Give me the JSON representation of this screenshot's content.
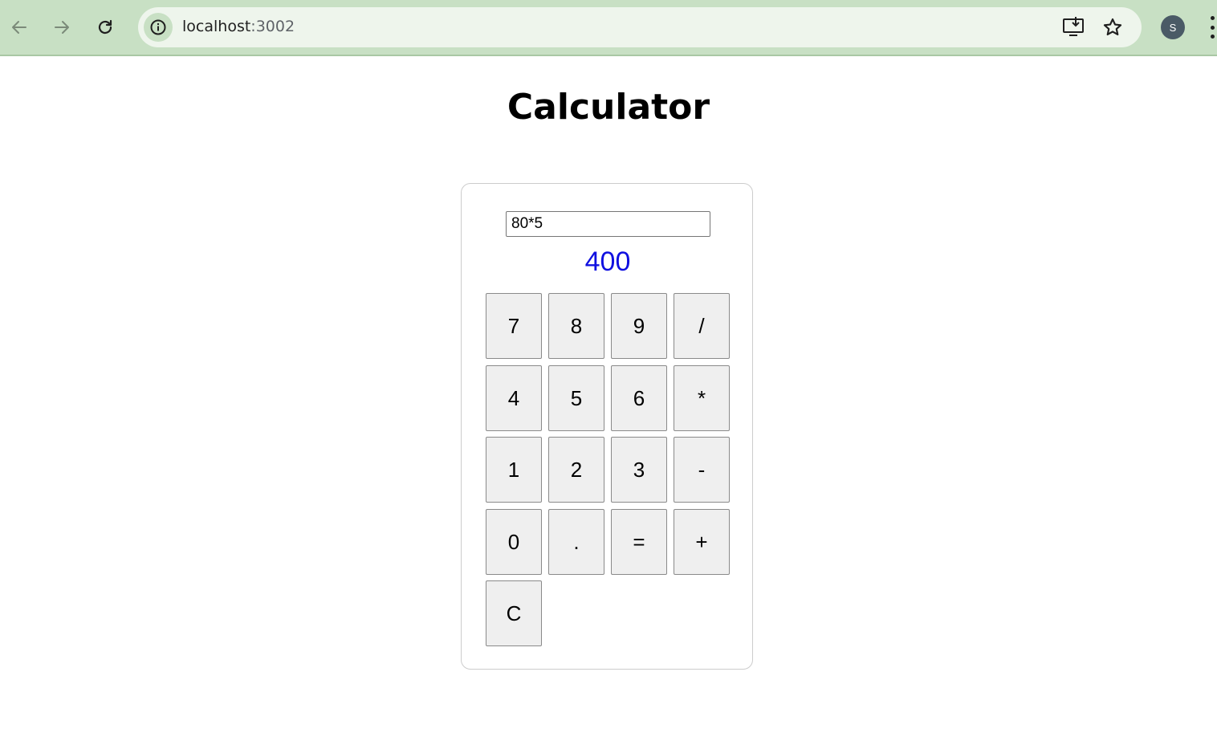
{
  "browser": {
    "url_host": "localhost",
    "url_port": ":3002",
    "profile_initial": "S",
    "icons": {
      "back": "arrow-left-icon",
      "forward": "arrow-right-icon",
      "reload": "reload-icon",
      "site_info": "info-icon",
      "install": "install-app-icon",
      "bookmark": "star-icon",
      "menu": "kebab-menu-icon"
    },
    "colors": {
      "toolbar": "#c8e0c4",
      "omnibox": "#eef5ec",
      "avatar": "#4a5a66"
    }
  },
  "page": {
    "title": "Calculator"
  },
  "calculator": {
    "expression": "80*5",
    "result": "400",
    "result_color": "#1010e0",
    "keys": [
      {
        "label": "7"
      },
      {
        "label": "8"
      },
      {
        "label": "9"
      },
      {
        "label": "/"
      },
      {
        "label": "4"
      },
      {
        "label": "5"
      },
      {
        "label": "6"
      },
      {
        "label": "*"
      },
      {
        "label": "1"
      },
      {
        "label": "2"
      },
      {
        "label": "3"
      },
      {
        "label": "-"
      },
      {
        "label": "0"
      },
      {
        "label": "."
      },
      {
        "label": "="
      },
      {
        "label": "+"
      },
      {
        "label": "C"
      }
    ]
  }
}
